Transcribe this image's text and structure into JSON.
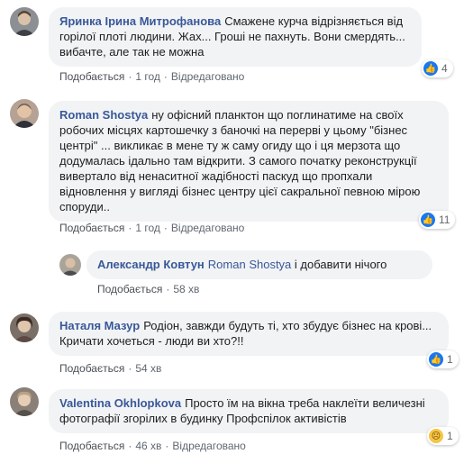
{
  "ui": {
    "like_label": "Подобається",
    "edited_label": "Відредаговано",
    "separator": "·"
  },
  "comments": [
    {
      "author": "Яринка Ірина Митрофанова",
      "text": "Смажене курча відрізняється від горілої плоті людини. Жах... Гроші не пахнуть. Вони смердять... вибачте, але так не можна",
      "time": "1 год",
      "edited": true,
      "reactions": {
        "icon": "like-icon",
        "count": "4"
      }
    },
    {
      "author": "Roman Shostya",
      "text": "ну офісний планктон що поглинатиме на своїх робочих місцях картошечку з баночкі на перерві у цьому \"бізнес центрі\" ... викликає в мене ту ж саму огиду що і ця мерзота що додумалась ідально там відкрити. З самого початку реконструкції вивертало від ненаситної жадібності паскуд що пропхали відновлення у вигляді бізнес центру цієї сакральної певною мірою споруди..",
      "time": "1 год",
      "edited": true,
      "reactions": {
        "icon": "like-icon",
        "count": "11"
      }
    },
    {
      "author": "Александр Ковтун",
      "mention": "Roman Shostya",
      "text": "і добавити нічого",
      "time": "58 хв",
      "edited": false
    },
    {
      "author": "Наталя Мазур",
      "text": "Родіон, завжди будуть ті, хто збудує бізнес на крові... Кричати хочеться - люди ви хто?!!",
      "time": "54 хв",
      "edited": false,
      "reactions": {
        "icon": "like-icon",
        "count": "1"
      }
    },
    {
      "author": "Valentina Okhlopkova",
      "text": "Просто їм на вікна треба наклеїти величезні фотографії згорілих в будинку Профспілок активістів",
      "time": "46 хв",
      "edited": true,
      "reactions": {
        "icon": "sad-icon",
        "count": "1"
      }
    }
  ]
}
